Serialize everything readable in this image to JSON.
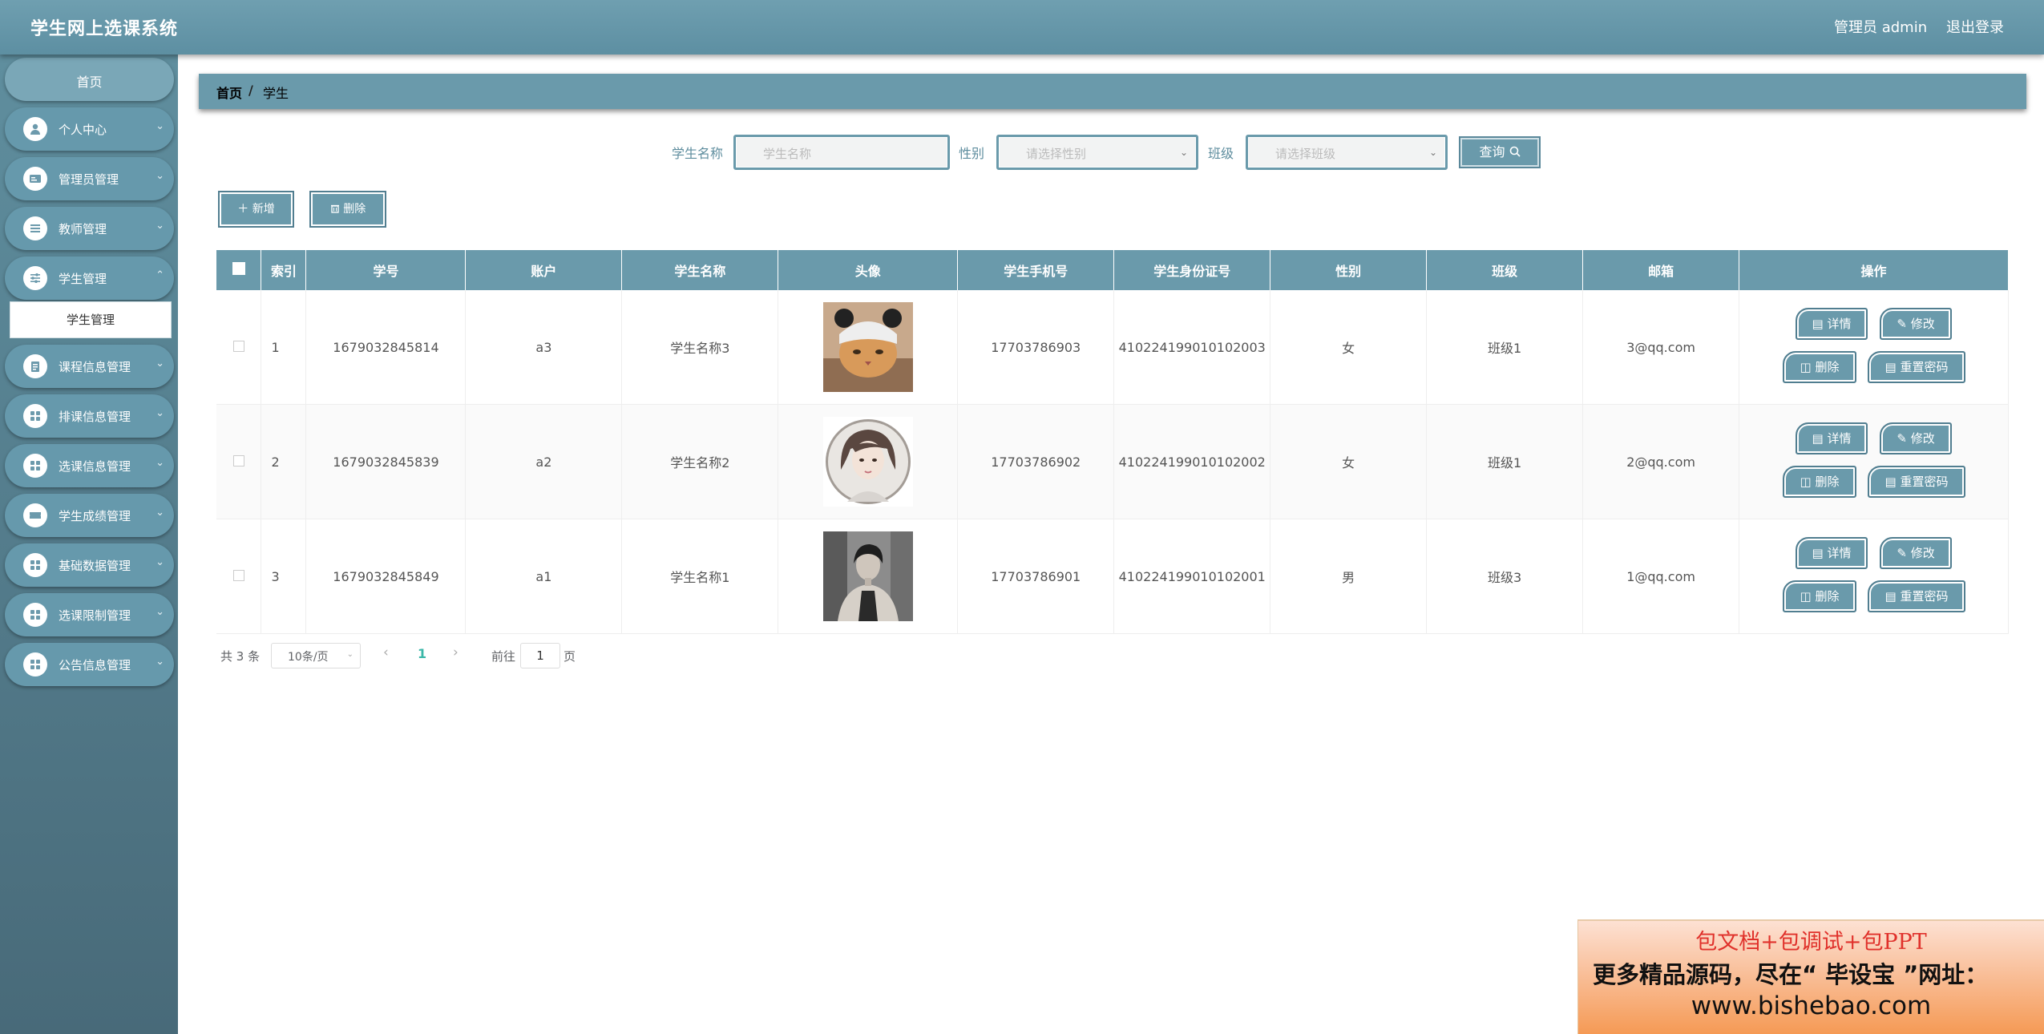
{
  "header": {
    "title": "学生网上选课系统",
    "admin_label": "管理员 admin",
    "logout": "退出登录"
  },
  "sidebar": {
    "home": "首页",
    "items": [
      {
        "label": "个人中心",
        "icon": "user-icon"
      },
      {
        "label": "管理员管理",
        "icon": "id-card-icon"
      },
      {
        "label": "教师管理",
        "icon": "list-icon"
      },
      {
        "label": "学生管理",
        "icon": "sliders-icon"
      },
      {
        "label": "课程信息管理",
        "icon": "clipboard-icon"
      },
      {
        "label": "排课信息管理",
        "icon": "grid-icon"
      },
      {
        "label": "选课信息管理",
        "icon": "grid-icon"
      },
      {
        "label": "学生成绩管理",
        "icon": "ticket-icon"
      },
      {
        "label": "基础数据管理",
        "icon": "grid-icon"
      },
      {
        "label": "选课限制管理",
        "icon": "grid-icon"
      },
      {
        "label": "公告信息管理",
        "icon": "grid-icon"
      }
    ],
    "active_sub": "学生管理"
  },
  "breadcrumb": {
    "home": "首页",
    "sep": "/",
    "current": "学生"
  },
  "filters": {
    "name_label": "学生名称",
    "name_placeholder": "学生名称",
    "gender_label": "性别",
    "gender_placeholder": "请选择性别",
    "class_label": "班级",
    "class_placeholder": "请选择班级",
    "query_label": "查询"
  },
  "actions": {
    "add": "新增",
    "delete": "删除"
  },
  "table": {
    "columns": [
      "索引",
      "学号",
      "账户",
      "学生名称",
      "头像",
      "学生手机号",
      "学生身份证号",
      "性别",
      "班级",
      "邮箱",
      "操作"
    ],
    "rows": [
      {
        "index": "1",
        "student_no": "1679032845814",
        "account": "a3",
        "name": "学生名称3",
        "avatar": "cat-avatar",
        "phone": "17703786903",
        "id_card": "410224199010102003",
        "gender": "女",
        "class": "班级1",
        "email": "3@qq.com"
      },
      {
        "index": "2",
        "student_no": "1679032845839",
        "account": "a2",
        "name": "学生名称2",
        "avatar": "girl-avatar",
        "phone": "17703786902",
        "id_card": "410224199010102002",
        "gender": "女",
        "class": "班级1",
        "email": "2@qq.com"
      },
      {
        "index": "3",
        "student_no": "1679032845849",
        "account": "a1",
        "name": "学生名称1",
        "avatar": "boy-avatar",
        "phone": "17703786901",
        "id_card": "410224199010102001",
        "gender": "男",
        "class": "班级3",
        "email": "1@qq.com"
      }
    ],
    "ops": {
      "detail": "详情",
      "edit": "修改",
      "delete": "删除",
      "reset": "重置密码"
    }
  },
  "pagination": {
    "total": "共 3 条",
    "page_size": "10条/页",
    "current_page": "1",
    "goto_label": "前往",
    "goto_value": "1",
    "page_unit": "页"
  },
  "promo": {
    "line1": "包文档+包调试+包PPT",
    "line2": "更多精品源码，尽在“ 毕设宝 ”网址：",
    "line3": "www.bishebao.com"
  },
  "colors": {
    "primary": "#6a9aab",
    "sidebar": "#5f8e9e",
    "accent": "#3bb7a8"
  }
}
